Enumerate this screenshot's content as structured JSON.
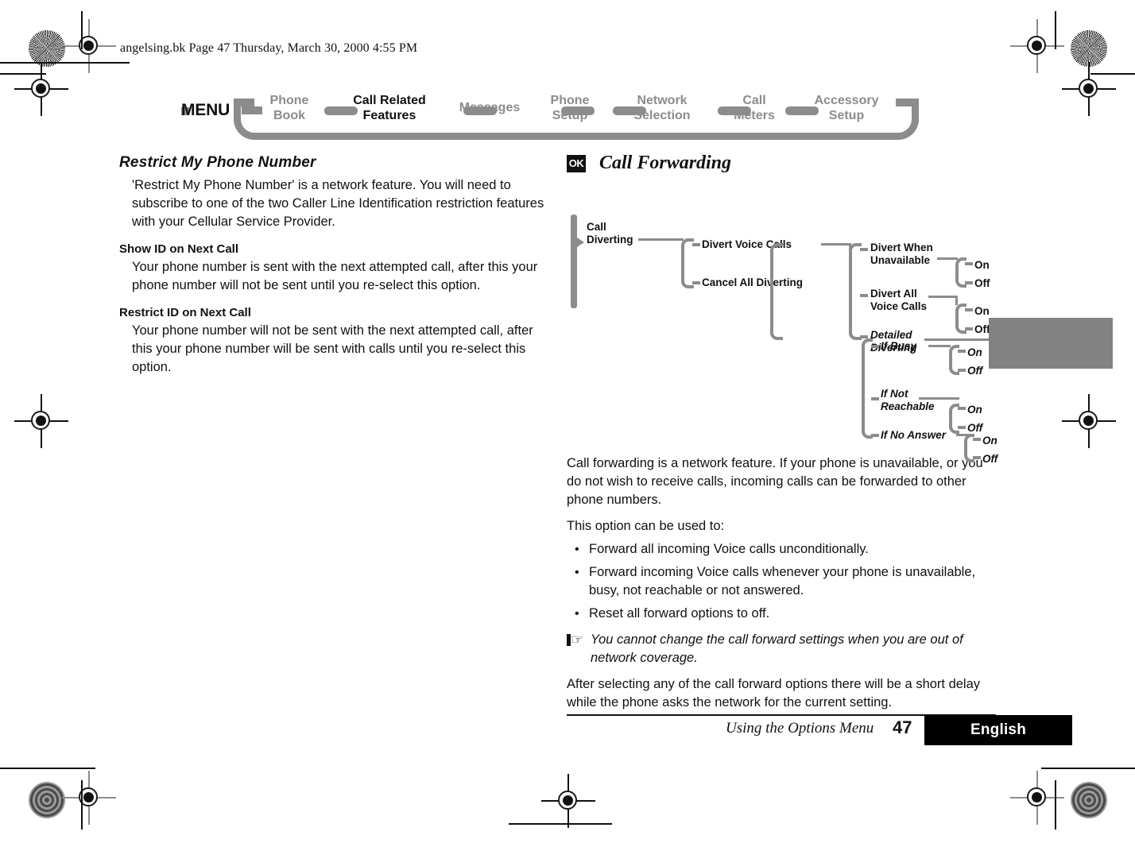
{
  "header": {
    "slug": "angelsing.bk  Page 47  Thursday, March 30, 2000  4:55 PM"
  },
  "nav": {
    "menu_label": "MENU",
    "items": [
      {
        "label": "Phone\nBook",
        "active": false
      },
      {
        "label": "Call Related\nFeatures",
        "active": true
      },
      {
        "label": "Messages",
        "active": false
      },
      {
        "label": "Phone\nSetup",
        "active": false
      },
      {
        "label": "Network\nSelection",
        "active": false
      },
      {
        "label": "Call\nMeters",
        "active": false
      },
      {
        "label": "Accessory\nSetup",
        "active": false
      }
    ]
  },
  "left_column": {
    "heading": "Restrict My Phone Number",
    "intro": "'Restrict My Phone Number' is a network feature. You will need to subscribe to one of the two Caller Line Identification restriction features with your Cellular Service Provider.",
    "sections": [
      {
        "title": "Show ID on Next Call",
        "body": "Your phone number is sent with the next attempted call, after this your phone number will not be sent until you re-select this option."
      },
      {
        "title": "Restrict ID on Next Call",
        "body": "Your phone number will not be sent with the next attempted call, after this your phone number will be sent with calls until you re-select this option."
      }
    ]
  },
  "right_column": {
    "ok_icon_label": "OK",
    "heading": "Call Forwarding",
    "paragraph_1": "Call forwarding is a network feature. If your phone is unavailable, or you do not wish to receive calls, incoming calls can be forwarded to other phone numbers.",
    "paragraph_2": "This option can be used to:",
    "bullets": [
      "Forward all incoming Voice calls unconditionally.",
      "Forward incoming Voice calls whenever your phone is unavailable, busy, not reachable or not answered.",
      "Reset all forward options to off."
    ],
    "note": "You cannot change the call forward settings when you are out of network coverage.",
    "paragraph_3": "After selecting any of the call forward options there will be a short delay while the phone asks the network for the current setting."
  },
  "menu_tree": {
    "root": "Call\nDiverting",
    "level1": [
      "Divert Voice Calls",
      "Cancel All Diverting"
    ],
    "level2": [
      "Divert When\nUnavailable",
      "Divert All\nVoice Calls",
      "Detailed\nDiverting"
    ],
    "level3": [
      "If Busy",
      "If Not\nReachable",
      "If No Answer"
    ],
    "toggle_on": "On",
    "toggle_off": "Off"
  },
  "footer": {
    "title": "Using the Options Menu",
    "page_number": "47",
    "language": "English"
  },
  "colors": {
    "nav_gray": "#8c8c8c",
    "tab_gray": "#828282",
    "ink": "#111111"
  }
}
